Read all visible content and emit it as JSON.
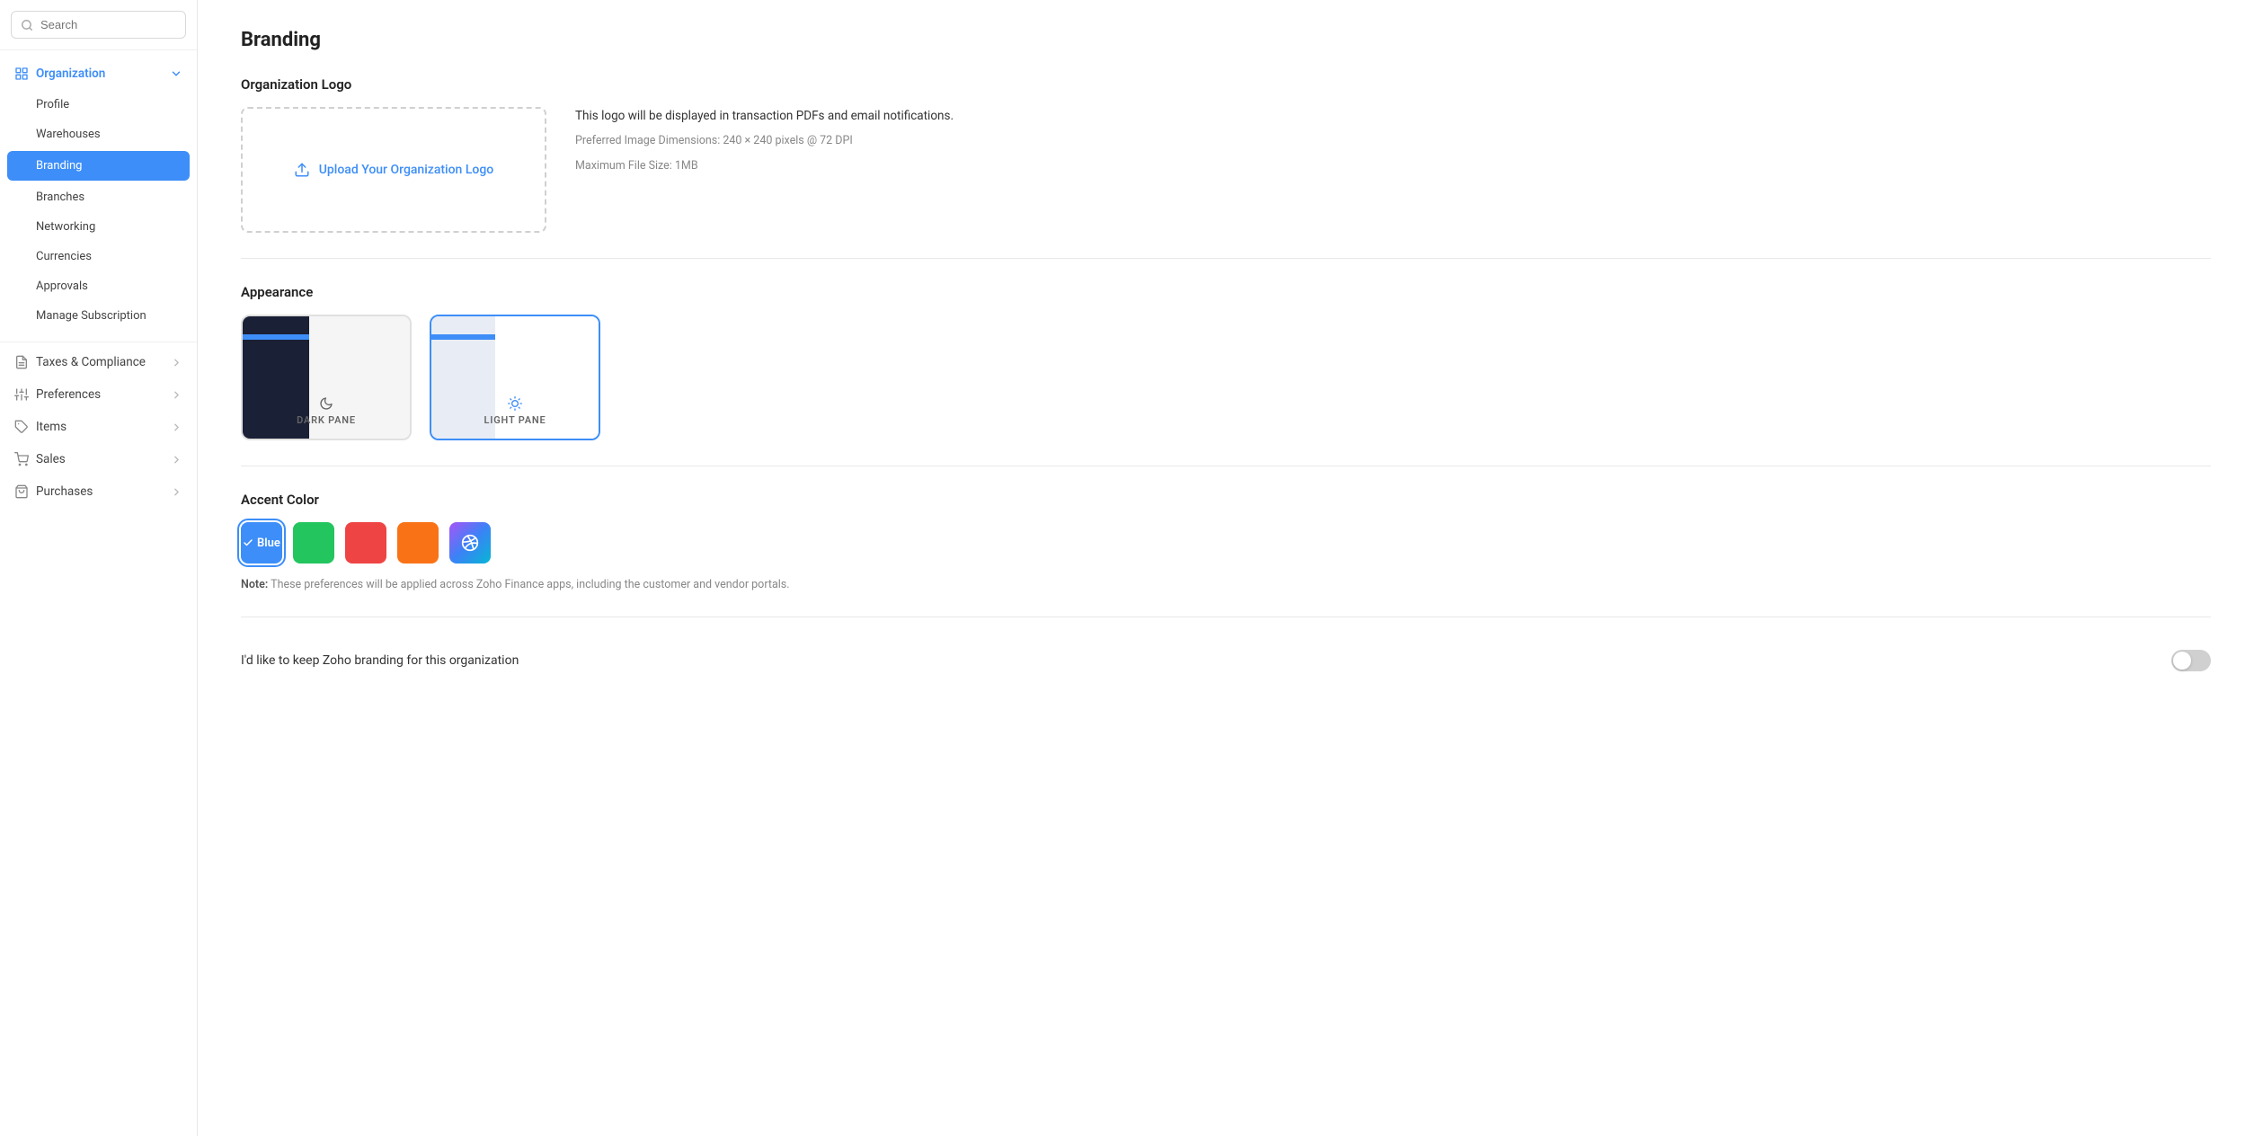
{
  "sidebar": {
    "search": {
      "placeholder": "Search"
    },
    "organization": {
      "label": "Organization",
      "icon": "building-icon"
    },
    "nav_items": [
      {
        "id": "profile",
        "label": "Profile",
        "active": false
      },
      {
        "id": "warehouses",
        "label": "Warehouses",
        "active": false
      },
      {
        "id": "branding",
        "label": "Branding",
        "active": true
      },
      {
        "id": "branches",
        "label": "Branches",
        "active": false
      },
      {
        "id": "networking",
        "label": "Networking",
        "active": false
      },
      {
        "id": "currencies",
        "label": "Currencies",
        "active": false
      },
      {
        "id": "approvals",
        "label": "Approvals",
        "active": false
      },
      {
        "id": "manage-subscription",
        "label": "Manage Subscription",
        "active": false
      }
    ],
    "top_items": [
      {
        "id": "taxes",
        "label": "Taxes & Compliance",
        "icon": "receipt-icon"
      },
      {
        "id": "preferences",
        "label": "Preferences",
        "icon": "sliders-icon"
      },
      {
        "id": "items",
        "label": "Items",
        "icon": "tag-icon"
      },
      {
        "id": "sales",
        "label": "Sales",
        "icon": "cart-icon"
      },
      {
        "id": "purchases",
        "label": "Purchases",
        "icon": "bag-icon"
      }
    ]
  },
  "main": {
    "page_title": "Branding",
    "sections": {
      "organization_logo": {
        "label": "Organization Logo",
        "upload_label": "Upload Your Organization Logo",
        "info_primary": "This logo will be displayed in transaction PDFs and email notifications.",
        "info_dimensions": "Preferred Image Dimensions: 240 × 240 pixels @ 72 DPI",
        "info_filesize": "Maximum File Size: 1MB"
      },
      "appearance": {
        "label": "Appearance",
        "cards": [
          {
            "id": "dark",
            "label": "DARK PANE",
            "selected": false
          },
          {
            "id": "light",
            "label": "LIGHT PANE",
            "selected": true
          }
        ]
      },
      "accent_color": {
        "label": "Accent Color",
        "colors": [
          {
            "id": "blue",
            "label": "Blue",
            "hex": "#3d8ef8",
            "selected": true
          },
          {
            "id": "green",
            "label": "Green",
            "hex": "#22c55e",
            "selected": false
          },
          {
            "id": "red",
            "label": "Red",
            "hex": "#ef4444",
            "selected": false
          },
          {
            "id": "orange",
            "label": "Orange",
            "hex": "#f97316",
            "selected": false
          },
          {
            "id": "custom",
            "label": "Custom",
            "hex": "gradient",
            "selected": false
          }
        ],
        "note_prefix": "Note:",
        "note_text": " These preferences will be applied across Zoho Finance apps, including the customer and vendor portals."
      },
      "zoho_branding": {
        "label": "I'd like to keep Zoho branding for this organization",
        "enabled": false
      }
    }
  }
}
